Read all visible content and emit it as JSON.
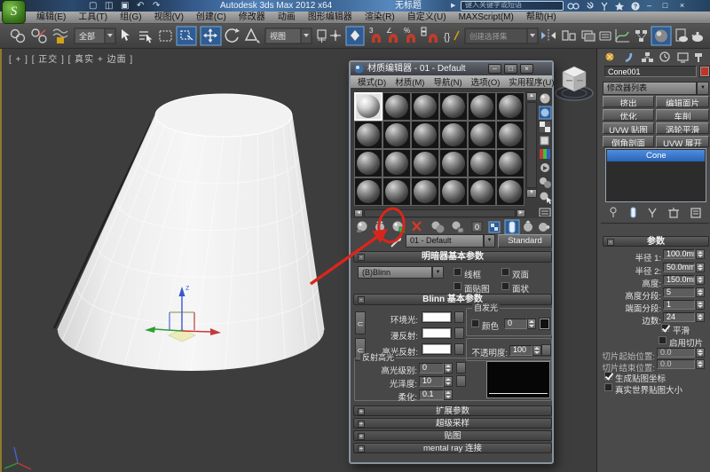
{
  "window": {
    "title": "Autodesk 3ds Max  2012 x64",
    "doc_title": "无标题",
    "search_placeholder": "键入关键字或短语",
    "icons": {
      "minimize": "–",
      "maximize": "□",
      "close": "×",
      "logo": "S"
    }
  },
  "menubar": {
    "items": [
      "编辑(E)",
      "工具(T)",
      "组(G)",
      "视图(V)",
      "创建(C)",
      "修改器",
      "动画",
      "图形编辑器",
      "渲染(R)",
      "自定义(U)",
      "MAXScript(M)",
      "帮助(H)"
    ]
  },
  "toolbar": {
    "selection_filter": "全部",
    "ref_coord": "视图",
    "named_selection": "创建选择集"
  },
  "viewport": {
    "label": "[ + ] [ 正交 ] [ 真实 + 边面 ]",
    "gizmo_axis": "z"
  },
  "material_editor": {
    "title": "材质编辑器 - 01 - Default",
    "menus": [
      "模式(D)",
      "材质(M)",
      "导航(N)",
      "选项(O)",
      "实用程序(U)"
    ],
    "material_name": "01 - Default",
    "type_button": "Standard",
    "shader_rollout": "明暗器基本参数",
    "shader_type": "(B)Blinn",
    "opt_wireframe": "线框",
    "opt_twosided": "双面",
    "opt_facemap": "面贴图",
    "opt_faceted": "面状",
    "blinn_rollout": "Blinn 基本参数",
    "ambient_label": "环境光:",
    "diffuse_label": "漫反射:",
    "specular_label": "高光反射:",
    "selfillum_group": "自发光",
    "selfillum_color_label": "颜色",
    "selfillum_value": "0",
    "opacity_label": "不透明度:",
    "opacity_value": "100",
    "specular_group": "反射高光",
    "spec_level_label": "高光级别:",
    "spec_level_value": "0",
    "gloss_label": "光泽度:",
    "gloss_value": "10",
    "soften_label": "柔化:",
    "soften_value": "0.1",
    "rollouts_collapsed": [
      "扩展参数",
      "超级采样",
      "贴图",
      "mental ray 连接"
    ]
  },
  "command_panel": {
    "object_name": "Cone001",
    "modifier_list_label": "修改器列表",
    "modifier_buttons": [
      "挤出",
      "编辑面片",
      "优化",
      "车削",
      "UVW 贴图",
      "涡轮平滑",
      "倒角剖面",
      "UVW 展开"
    ],
    "stack_item": "Cone",
    "params_rollout": "参数",
    "radius1_label": "半径 1:",
    "radius1_value": "100.0mm",
    "radius2_label": "半径 2:",
    "radius2_value": "50.0mm",
    "height_label": "高度:",
    "height_value": "150.0mm",
    "hseg_label": "高度分段:",
    "hseg_value": "5",
    "cseg_label": "端面分段:",
    "cseg_value": "1",
    "sides_label": "边数:",
    "sides_value": "24",
    "smooth_label": "平滑",
    "slice_on_label": "启用切片",
    "slice_from_label": "切片起始位置:",
    "slice_from_value": "0.0",
    "slice_to_label": "切片结束位置:",
    "slice_to_value": "0.0",
    "gen_map_label": "生成贴图坐标",
    "real_world_label": "真实世界贴图大小"
  },
  "colors": {
    "annotation_red": "#d9261c",
    "highlight_blue": "#2f5d93",
    "stack_blue": "#2a63b8",
    "object_color_swatch": "#c03427",
    "active_border_yellow": "#8f7a2e"
  }
}
